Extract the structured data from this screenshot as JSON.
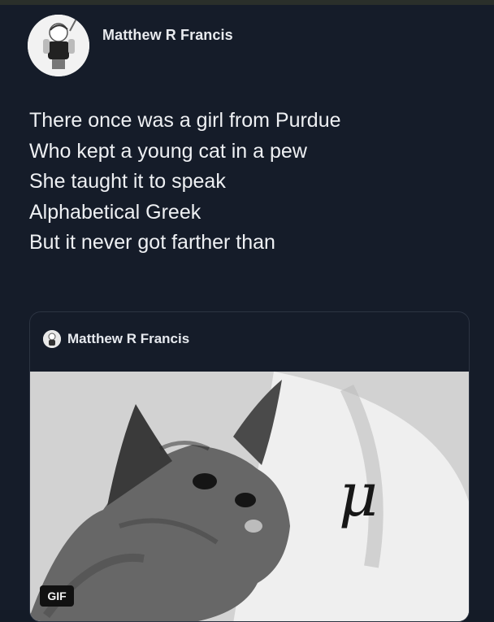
{
  "post": {
    "author": "Matthew R Francis",
    "lines": [
      "There once was a girl from Purdue",
      "Who kept a young cat in a pew",
      "She taught it to speak",
      "Alphabetical Greek",
      "But it never got farther than"
    ]
  },
  "quote": {
    "author": "Matthew R Francis",
    "media_overlay": "μ",
    "badge": "GIF"
  },
  "colors": {
    "background": "#151c29",
    "text": "#eef0f3",
    "card_border": "#2c3442"
  },
  "icons": {
    "avatar": "profile-avatar",
    "quote_avatar": "quote-profile-avatar"
  }
}
